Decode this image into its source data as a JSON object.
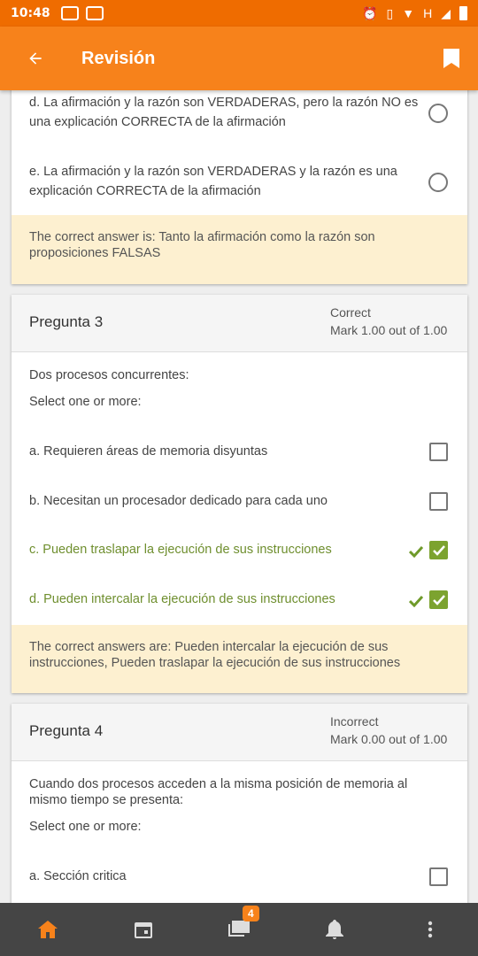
{
  "status": {
    "time": "10:48",
    "net": "H"
  },
  "appbar": {
    "title": "Revisión"
  },
  "q2": {
    "options": [
      {
        "text": "d. La afirmación y la razón son VERDADERAS, pero la razón NO es una explicación CORRECTA de la afirmación"
      },
      {
        "text": "e. La afirmación y la razón son VERDADERAS y la razón es una explicación CORRECTA de la afirmación"
      }
    ],
    "feedback": "The correct answer is: Tanto la afirmación como la razón son proposiciones FALSAS"
  },
  "q3": {
    "title": "Pregunta 3",
    "state": "Correct",
    "mark": "Mark 1.00 out of 1.00",
    "question": "Dos procesos concurrentes:",
    "prompt": "Select one or more:",
    "options": [
      {
        "text": "a. Requieren áreas de memoria disyuntas",
        "checked": false,
        "correct": false
      },
      {
        "text": "b. Necesitan un procesador dedicado para cada uno",
        "checked": false,
        "correct": false
      },
      {
        "text": "c. Pueden traslapar la ejecución de sus instrucciones",
        "checked": true,
        "correct": true
      },
      {
        "text": "d. Pueden intercalar la ejecución de sus instrucciones",
        "checked": true,
        "correct": true
      }
    ],
    "feedback": "The correct answers are: Pueden intercalar la ejecución de sus instrucciones, Pueden traslapar la ejecución de sus instrucciones"
  },
  "q4": {
    "title": "Pregunta 4",
    "state": "Incorrect",
    "mark": "Mark 0.00 out of 1.00",
    "question": "Cuando dos procesos acceden a la misma posición de memoria al mismo tiempo se presenta:",
    "prompt": "Select one or more:",
    "options": [
      {
        "text": "a. Sección critica",
        "checked": false
      }
    ]
  },
  "nav": {
    "messages_badge": "4"
  },
  "colors": {
    "accent": "#f7821b",
    "correct": "#7ca32f",
    "feedback_bg": "#fdf0d0"
  }
}
